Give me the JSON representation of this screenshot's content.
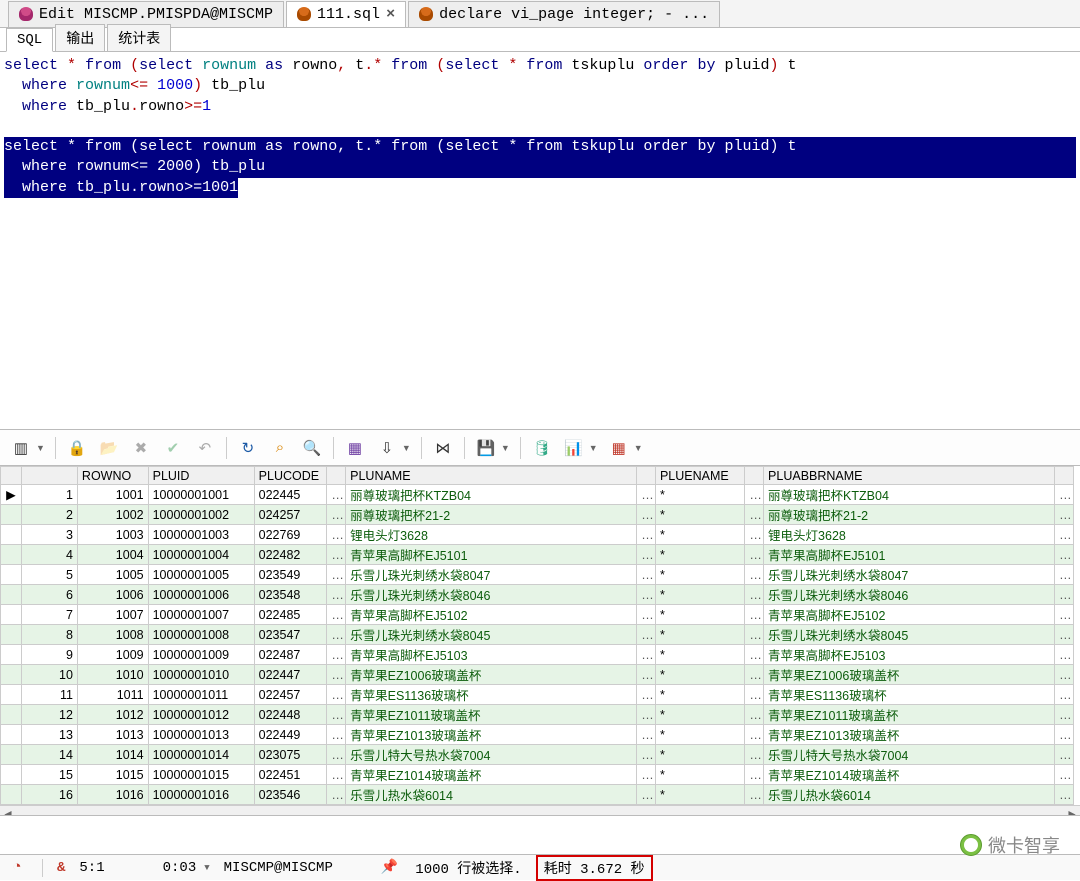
{
  "top_tabs": {
    "t0": "Edit MISCMP.PMISPDA@MISCMP",
    "t1": "111.sql",
    "t2": "declare vi_page integer; - ..."
  },
  "sub_tabs": {
    "sql": "SQL",
    "output": "输出",
    "stats": "统计表"
  },
  "sql": {
    "q1l1": "select * from (select rownum as rowno, t.* from (select * from tskuplu order by pluid) t",
    "q1l2": "  where rownum<= 1000) tb_plu",
    "q1l3": "  where tb_plu.rowno>=1",
    "q2l1": "select * from (select rownum as rowno, t.* from (select * from tskuplu order by pluid) t",
    "q2l2": "  where rownum<= 2000) tb_plu",
    "q2l3": "  where tb_plu.rowno>=1001"
  },
  "grid": {
    "headers": {
      "rowno": "ROWNO",
      "pluid": "PLUID",
      "plucode": "PLUCODE",
      "pluname": "PLUNAME",
      "pluename": "PLUENAME",
      "pluabbrname": "PLUABBRNAME"
    },
    "rows": [
      {
        "n": 1,
        "rowno": 1001,
        "pluid": "10000001001",
        "plucode": "022445",
        "pluname": "丽尊玻璃把杯KTZB04",
        "pluename": "*",
        "abbr": "丽尊玻璃把杯KTZB04"
      },
      {
        "n": 2,
        "rowno": 1002,
        "pluid": "10000001002",
        "plucode": "024257",
        "pluname": "丽尊玻璃把杯21-2",
        "pluename": "*",
        "abbr": "丽尊玻璃把杯21-2"
      },
      {
        "n": 3,
        "rowno": 1003,
        "pluid": "10000001003",
        "plucode": "022769",
        "pluname": "锂电头灯3628",
        "pluename": "*",
        "abbr": "锂电头灯3628"
      },
      {
        "n": 4,
        "rowno": 1004,
        "pluid": "10000001004",
        "plucode": "022482",
        "pluname": "青苹果高脚杯EJ5101",
        "pluename": "*",
        "abbr": "青苹果高脚杯EJ5101"
      },
      {
        "n": 5,
        "rowno": 1005,
        "pluid": "10000001005",
        "plucode": "023549",
        "pluname": "乐雪儿珠光刺绣水袋8047",
        "pluename": "*",
        "abbr": "乐雪儿珠光刺绣水袋8047"
      },
      {
        "n": 6,
        "rowno": 1006,
        "pluid": "10000001006",
        "plucode": "023548",
        "pluname": "乐雪儿珠光刺绣水袋8046",
        "pluename": "*",
        "abbr": "乐雪儿珠光刺绣水袋8046"
      },
      {
        "n": 7,
        "rowno": 1007,
        "pluid": "10000001007",
        "plucode": "022485",
        "pluname": "青苹果高脚杯EJ5102",
        "pluename": "*",
        "abbr": "青苹果高脚杯EJ5102"
      },
      {
        "n": 8,
        "rowno": 1008,
        "pluid": "10000001008",
        "plucode": "023547",
        "pluname": "乐雪儿珠光刺绣水袋8045",
        "pluename": "*",
        "abbr": "乐雪儿珠光刺绣水袋8045"
      },
      {
        "n": 9,
        "rowno": 1009,
        "pluid": "10000001009",
        "plucode": "022487",
        "pluname": "青苹果高脚杯EJ5103",
        "pluename": "*",
        "abbr": "青苹果高脚杯EJ5103"
      },
      {
        "n": 10,
        "rowno": 1010,
        "pluid": "10000001010",
        "plucode": "022447",
        "pluname": "青苹果EZ1006玻璃盖杯",
        "pluename": "*",
        "abbr": "青苹果EZ1006玻璃盖杯"
      },
      {
        "n": 11,
        "rowno": 1011,
        "pluid": "10000001011",
        "plucode": "022457",
        "pluname": "青苹果ES1136玻璃杯",
        "pluename": "*",
        "abbr": "青苹果ES1136玻璃杯"
      },
      {
        "n": 12,
        "rowno": 1012,
        "pluid": "10000001012",
        "plucode": "022448",
        "pluname": "青苹果EZ1011玻璃盖杯",
        "pluename": "*",
        "abbr": "青苹果EZ1011玻璃盖杯"
      },
      {
        "n": 13,
        "rowno": 1013,
        "pluid": "10000001013",
        "plucode": "022449",
        "pluname": "青苹果EZ1013玻璃盖杯",
        "pluename": "*",
        "abbr": "青苹果EZ1013玻璃盖杯"
      },
      {
        "n": 14,
        "rowno": 1014,
        "pluid": "10000001014",
        "plucode": "023075",
        "pluname": "乐雪儿特大号热水袋7004",
        "pluename": "*",
        "abbr": "乐雪儿特大号热水袋7004"
      },
      {
        "n": 15,
        "rowno": 1015,
        "pluid": "10000001015",
        "plucode": "022451",
        "pluname": "青苹果EZ1014玻璃盖杯",
        "pluename": "*",
        "abbr": "青苹果EZ1014玻璃盖杯"
      },
      {
        "n": 16,
        "rowno": 1016,
        "pluid": "10000001016",
        "plucode": "023546",
        "pluname": "乐雪儿热水袋6014",
        "pluename": "*",
        "abbr": "乐雪儿热水袋6014"
      }
    ]
  },
  "status": {
    "cursor": "5:1",
    "time": "0:03",
    "conn": "MISCMP@MISCMP",
    "rows": "1000 行被选择.",
    "elapsed": "耗时 3.672 秒"
  },
  "watermark": "微卡智享",
  "glyph": {
    "amp": "&",
    "dots": "…",
    "arrow_r": "▶",
    "scroll_l": "◄",
    "scroll_r": "►",
    "dot": "●"
  }
}
